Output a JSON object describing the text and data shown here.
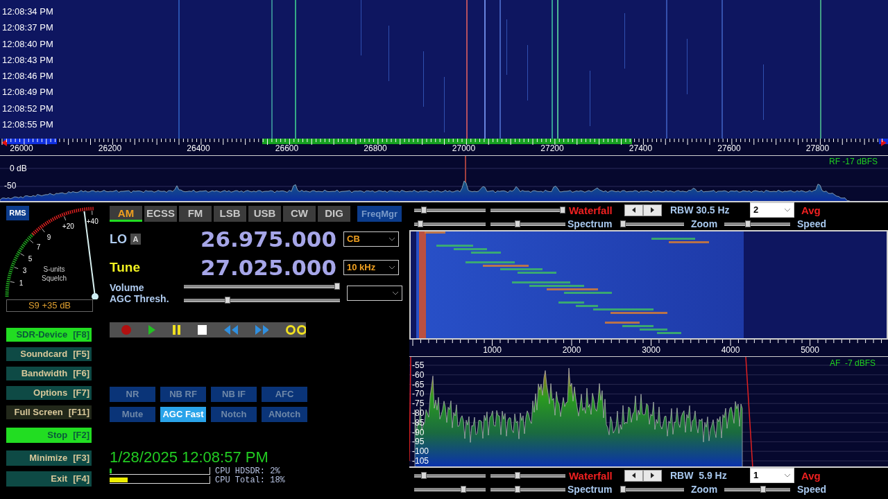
{
  "waterfall": {
    "times": [
      "12:08:34 PM",
      "12:08:37 PM",
      "12:08:40 PM",
      "12:08:43 PM",
      "12:08:46 PM",
      "12:08:49 PM",
      "12:08:52 PM",
      "12:08:55 PM"
    ]
  },
  "rf_axis": {
    "labels": [
      "26000",
      "26200",
      "26400",
      "26600",
      "26800",
      "27000",
      "27200",
      "27400",
      "27600",
      "27800"
    ]
  },
  "rf_spectrum": {
    "db_labels": [
      "0 dB",
      "-50"
    ],
    "reading": "RF -17 dBFS"
  },
  "meter": {
    "mode_button": "RMS",
    "scale_labels": [
      "1",
      "3",
      "5",
      "7",
      "9",
      "+20",
      "+40"
    ],
    "captions": [
      "S-units",
      "Squelch"
    ],
    "level": 0.92,
    "reading": "S9 +35 dB"
  },
  "left_buttons": [
    {
      "label": "SDR-Device",
      "key": "[F8]",
      "kind": "menu",
      "active": true
    },
    {
      "label": "Soundcard",
      "key": "[F5]",
      "kind": "menu",
      "active": false
    },
    {
      "label": "Bandwidth",
      "key": "[F6]",
      "kind": "menu",
      "active": false
    },
    {
      "label": "Options",
      "key": "[F7]",
      "kind": "menu",
      "active": false
    },
    {
      "label": "Full Screen",
      "key": "[F11]",
      "kind": "toggle",
      "active": false
    },
    {
      "label": "Stop",
      "key": "[F2]",
      "kind": "run",
      "active": true
    },
    {
      "label": "Minimize",
      "key": "[F3]",
      "kind": "menu",
      "active": false
    },
    {
      "label": "Exit",
      "key": "[F4]",
      "kind": "menu",
      "active": false
    }
  ],
  "modes": [
    {
      "label": "AM",
      "selected": true
    },
    {
      "label": "ECSS",
      "selected": false
    },
    {
      "label": "FM",
      "selected": false
    },
    {
      "label": "LSB",
      "selected": false
    },
    {
      "label": "USB",
      "selected": false
    },
    {
      "label": "CW",
      "selected": false
    },
    {
      "label": "DIG",
      "selected": false
    }
  ],
  "freq_manager": "FreqMgr",
  "lo": {
    "label": "LO",
    "badge": "A",
    "value": "26.975.000",
    "dropdown": "CB"
  },
  "tune": {
    "label": "Tune",
    "value": "27.025.000",
    "dropdown": "10 kHz"
  },
  "volume": {
    "label": "Volume",
    "level": 1.0
  },
  "agc_threshold": {
    "label": "AGC Thresh.",
    "level": 0.27
  },
  "dsp_buttons": [
    {
      "label": "NR",
      "on": false
    },
    {
      "label": "NB RF",
      "on": false
    },
    {
      "label": "NB IF",
      "on": false
    },
    {
      "label": "AFC",
      "on": false
    },
    {
      "label": "Mute",
      "on": false
    },
    {
      "label": "AGC Fast",
      "on": true
    },
    {
      "label": "Notch",
      "on": false
    },
    {
      "label": "ANotch",
      "on": false
    }
  ],
  "clock": "1/28/2025 12:08:57 PM",
  "cpu": [
    {
      "label": "CPU HDSDR: 2%",
      "level": 0.02,
      "color": "#22cc22"
    },
    {
      "label": "CPU Total: 18%",
      "level": 0.18,
      "color": "#eeee00"
    }
  ],
  "rf_controls": {
    "waterfall": "Waterfall",
    "rbw": "RBW 30.5 Hz",
    "avg_value": "2",
    "avg": "Avg",
    "spectrum": "Spectrum",
    "zoom": "Zoom",
    "speed": "Speed",
    "sliders": [
      {
        "level": 0.1
      },
      {
        "level": 1.0
      },
      {
        "level": 0.05
      },
      {
        "level": 0.35
      },
      {
        "level": 0.0
      },
      {
        "level": 0.35
      }
    ]
  },
  "af_axis": {
    "labels": [
      "1000",
      "2000",
      "3000",
      "4000",
      "5000"
    ]
  },
  "af_spectrum": {
    "db_labels": [
      "-55",
      "-60",
      "-65",
      "-70",
      "-75",
      "-80",
      "-85",
      "-90",
      "-95",
      "-100",
      "-105"
    ],
    "reading": "AF  -7 dBFS"
  },
  "af_controls": {
    "waterfall": "Waterfall",
    "rbw": "RBW  5.9 Hz",
    "avg_value": "1",
    "avg": "Avg",
    "spectrum": "Spectrum",
    "zoom": "Zoom",
    "speed": "Speed",
    "sliders": [
      {
        "level": 0.1
      },
      {
        "level": 0.35
      },
      {
        "level": 0.7
      },
      {
        "level": 0.35
      },
      {
        "level": 0.0
      },
      {
        "level": 0.6
      }
    ]
  }
}
